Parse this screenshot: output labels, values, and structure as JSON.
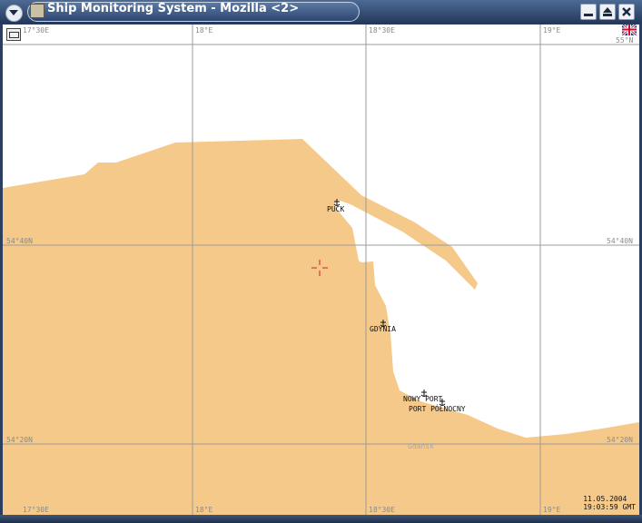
{
  "window": {
    "title": "Ship Monitoring System - Mozilla <2>",
    "buttons": [
      "minimize",
      "maximize",
      "close"
    ]
  },
  "map": {
    "longitude_labels": [
      "17°30E",
      "18°E",
      "18°30E",
      "19°E"
    ],
    "latitude_labels": [
      "55°N",
      "54°40N",
      "54°20N"
    ],
    "ports": [
      {
        "name": "PUCK"
      },
      {
        "name": "GDYNIA"
      },
      {
        "name": "NOWY PORT"
      },
      {
        "name": "PORT PÓŁNOCNY"
      }
    ],
    "city_label": "Gdańsk",
    "colors": {
      "land": "#f5c98a",
      "sea": "#ffffff",
      "grid": "#9b9b9b",
      "cursor": "#d22020"
    }
  },
  "timestamp": {
    "date": "11.05.2004",
    "time": "19:03:59 GMT"
  }
}
